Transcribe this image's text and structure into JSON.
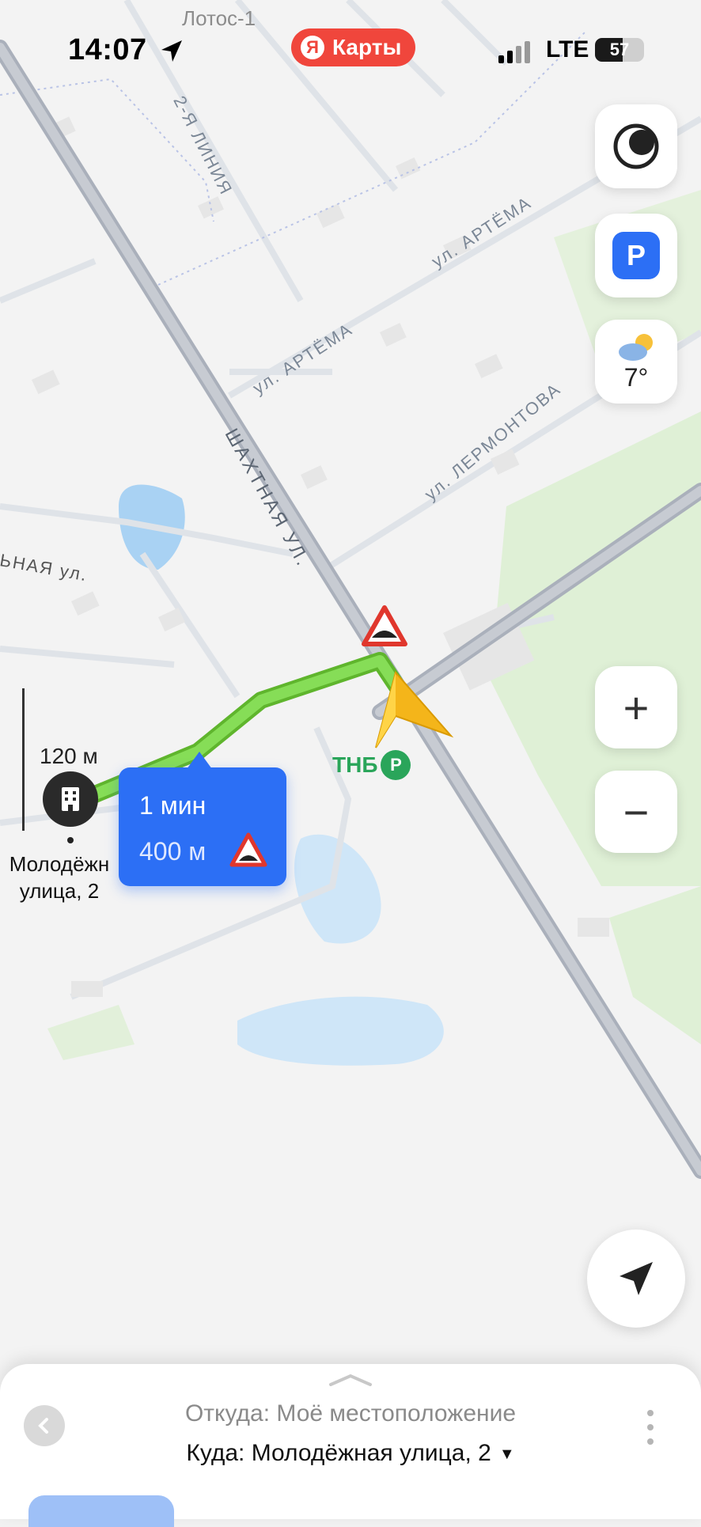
{
  "status_bar": {
    "time": "14:07",
    "app_name": "Карты",
    "app_logo_letter": "Я",
    "network": "LTE",
    "battery": "57",
    "battery_level": 0.57
  },
  "map": {
    "top_place_label": "Лотос-1",
    "streets": {
      "liniya_2": "2-Я ЛИНИЯ",
      "artema_1": "ул. АРТЁМА",
      "artema_2": "ул. АРТЁМА",
      "lermontova": "ул. ЛЕРМОНТОВА",
      "shakhtnaya": "ШАХТНАЯ УЛ.",
      "nay_ul": "ЬНАЯ ул."
    },
    "scale": "120 м",
    "poi_name": "ТНБ",
    "poi_icon_text": "P",
    "destination_pin_label": "Молодёжн\nулица, 2"
  },
  "controls": {
    "parking": "P",
    "weather_temp": "7°",
    "zoom_in": "+",
    "zoom_out": "−"
  },
  "route_bubble": {
    "time": "1 мин",
    "distance": "400 м"
  },
  "bottom_sheet": {
    "from": "Откуда: Моё местоположение",
    "to": "Куда: Молодёжная улица, 2",
    "to_caret": "▼"
  },
  "colors": {
    "brand_red": "#f0463c",
    "route_green": "#7ed957",
    "bubble_blue": "#2c6ff5",
    "road_gray": "#a7adb8",
    "poi_green": "#2aa55a"
  }
}
